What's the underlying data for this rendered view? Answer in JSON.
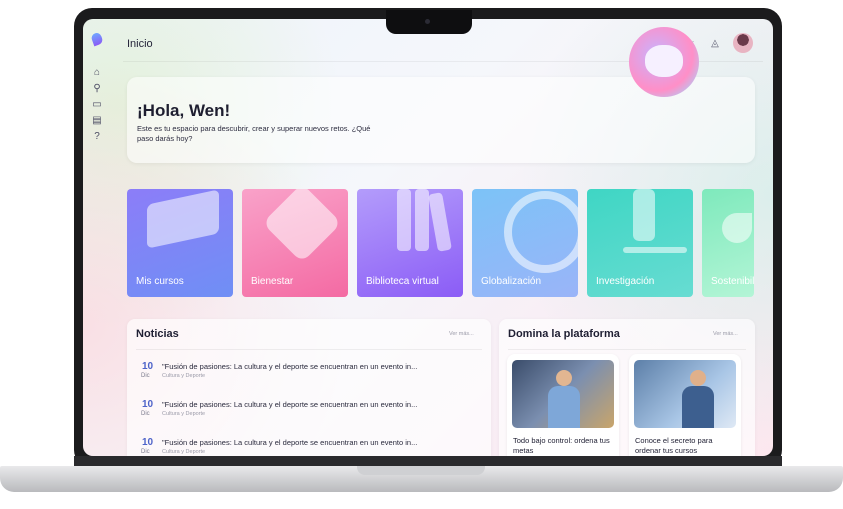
{
  "header": {
    "page_title": "Inicio"
  },
  "sidebar": {
    "items": [
      {
        "icon": "home-icon",
        "glyph": "⌂"
      },
      {
        "icon": "graduation-cap-icon",
        "glyph": "⚲"
      },
      {
        "icon": "calendar-icon",
        "glyph": "▭"
      },
      {
        "icon": "card-icon",
        "glyph": "▤"
      },
      {
        "icon": "help-icon",
        "glyph": "?"
      }
    ]
  },
  "hero": {
    "title": "¡Hola, Wen!",
    "text": "Este es tu espacio para descubrir, crear y superar nuevos retos. ¿Qué paso darás hoy?"
  },
  "cards": [
    {
      "label": "Mis cursos",
      "color1": "#8b7cf8",
      "color2": "#6f8ff5"
    },
    {
      "label": "Bienestar",
      "color1": "#f78fbf",
      "color2": "#f46aa3"
    },
    {
      "label": "Biblioteca virtual",
      "color1": "#a78bfa",
      "color2": "#8b5cf6"
    },
    {
      "label": "Globalización",
      "color1": "#60b6f5",
      "color2": "#8ab4f8"
    },
    {
      "label": "Investigación",
      "color1": "#34d3c0",
      "color2": "#5fdbd0"
    },
    {
      "label": "Sostenibilidad",
      "color1": "#6ee7b7",
      "color2": "#a7f3d0"
    }
  ],
  "news": {
    "title": "Noticias",
    "more": "Ver más...",
    "items": [
      {
        "day": "10",
        "month": "Dic",
        "title": "\"Fusión de pasiones: La cultura y el deporte se encuentran en un evento in...",
        "category": "Cultura y Deporte"
      },
      {
        "day": "10",
        "month": "Dic",
        "title": "\"Fusión de pasiones: La cultura y el deporte se encuentran en un evento in...",
        "category": "Cultura y Deporte"
      },
      {
        "day": "10",
        "month": "Dic",
        "title": "\"Fusión de pasiones: La cultura y el deporte se encuentran en un evento in...",
        "category": "Cultura y Deporte"
      }
    ]
  },
  "platform": {
    "title": "Domina la plataforma",
    "more": "Ver más...",
    "videos": [
      {
        "title": "Todo bajo control: ordena tus metas"
      },
      {
        "title": "Conoce el secreto para ordenar tus cursos"
      }
    ]
  },
  "colors": {
    "accent": "#4d63c9"
  }
}
